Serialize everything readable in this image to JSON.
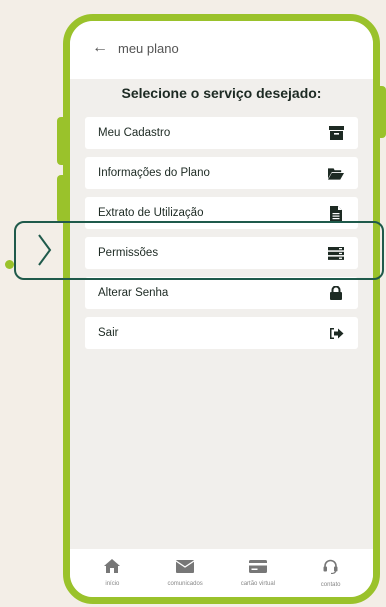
{
  "header": {
    "back_label": "meu plano"
  },
  "title": "Selecione o serviço desejado:",
  "menu": [
    {
      "label": "Meu Cadastro",
      "icon": "archive-icon"
    },
    {
      "label": "Informações do Plano",
      "icon": "folder-open-icon"
    },
    {
      "label": "Extrato de Utilização",
      "icon": "document-icon"
    },
    {
      "label": "Permissões",
      "icon": "list-icon"
    },
    {
      "label": "Alterar Senha",
      "icon": "lock-icon"
    },
    {
      "label": "Sair",
      "icon": "sign-out-icon"
    }
  ],
  "tabbar": [
    {
      "label": "início",
      "icon": "home-icon"
    },
    {
      "label": "comunicados",
      "icon": "envelope-icon"
    },
    {
      "label": "cartão virtual",
      "icon": "credit-card-icon"
    },
    {
      "label": "contato",
      "icon": "headset-icon"
    }
  ],
  "colors": {
    "accent": "#9ac22b",
    "callout": "#1f5a4b",
    "text": "#1d2a23"
  }
}
